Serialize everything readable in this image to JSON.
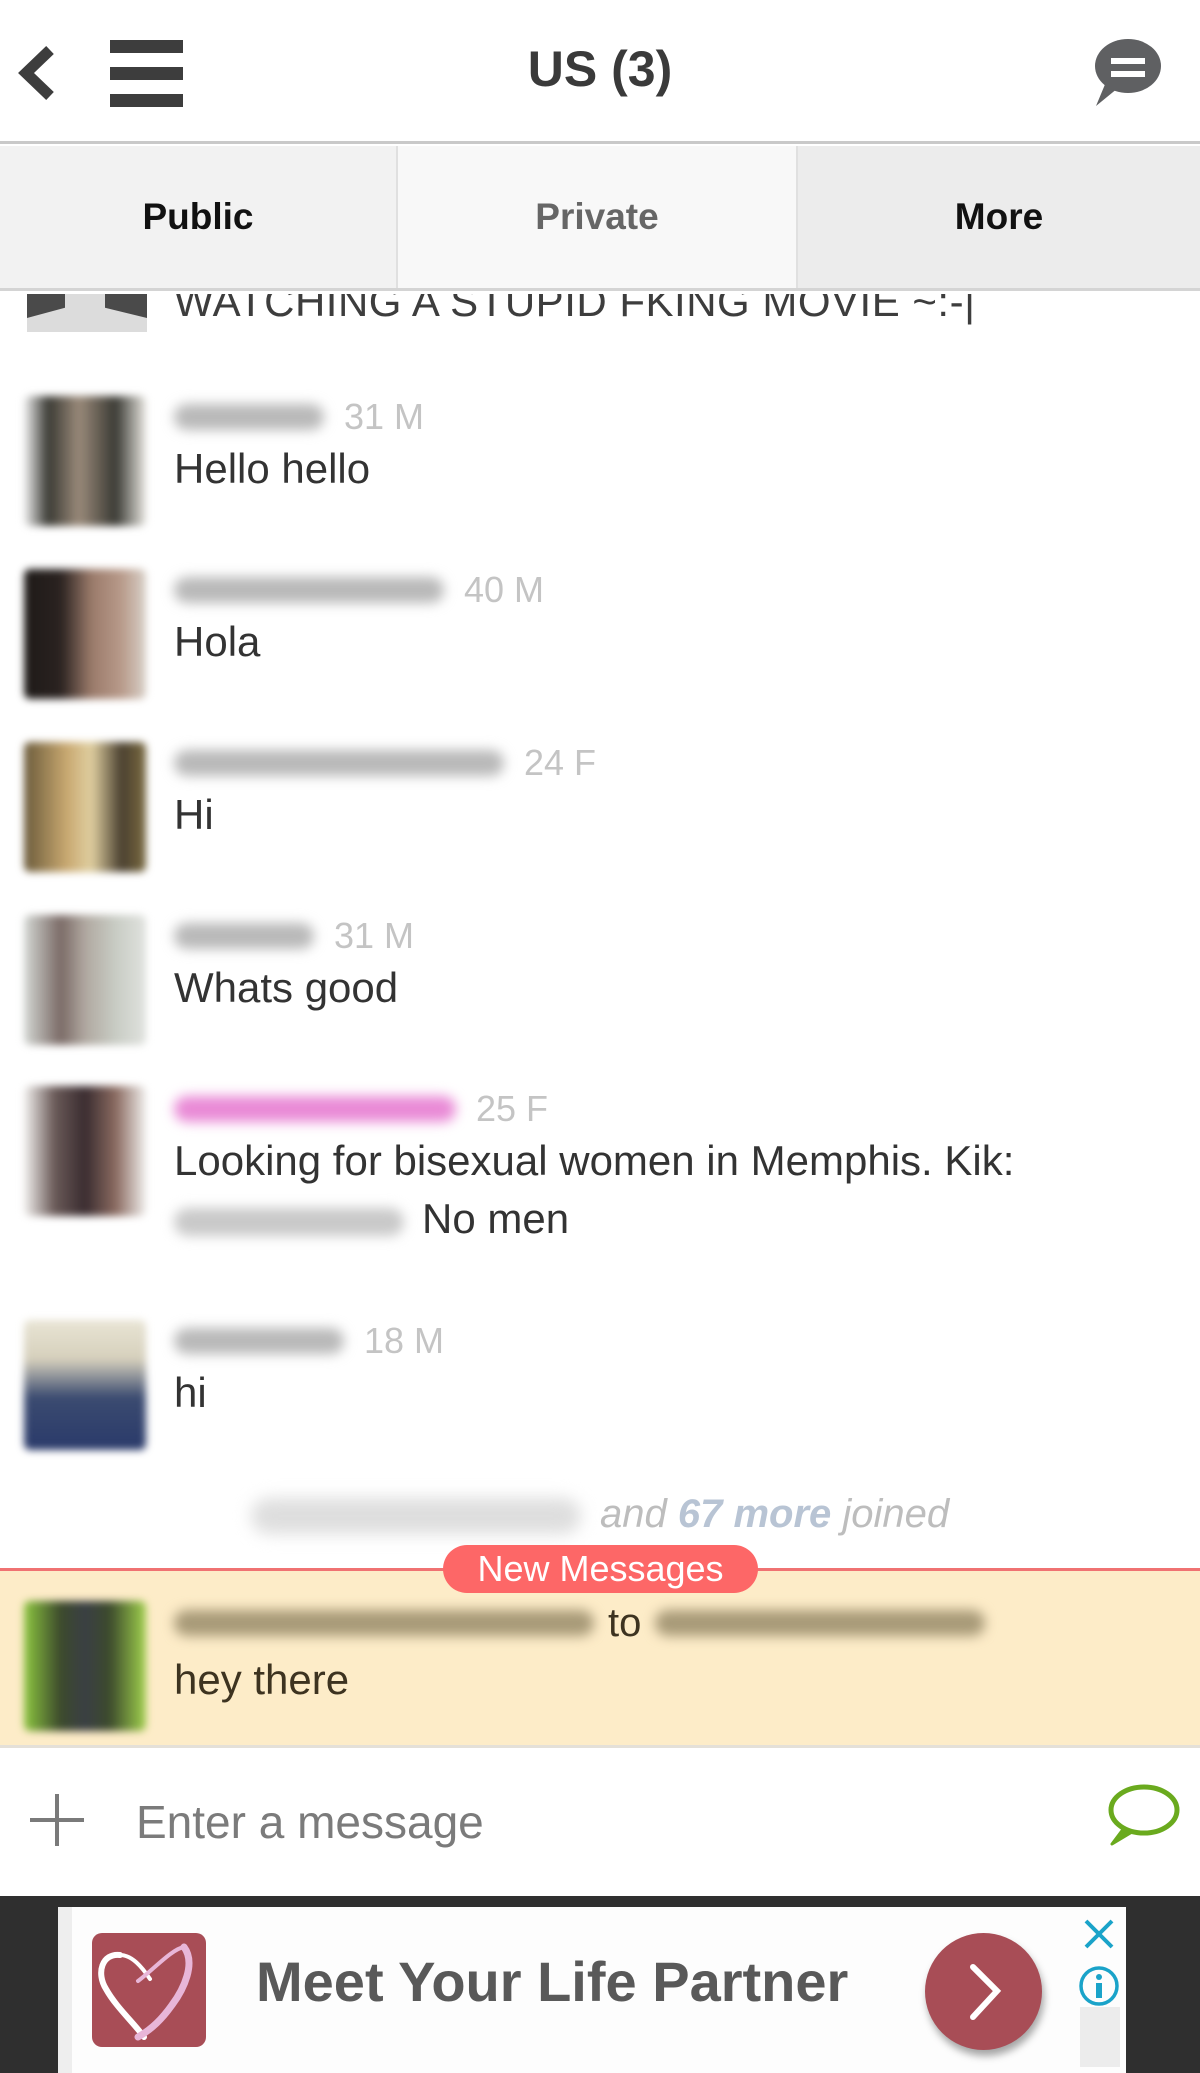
{
  "header": {
    "title": "US (3)",
    "back_icon": "chevron-left-icon",
    "menu_icon": "hamburger-menu-icon",
    "chat_icon": "chat-bubble-icon"
  },
  "tabs": [
    {
      "label": "Public",
      "active": true
    },
    {
      "label": "Private",
      "active": false
    },
    {
      "label": "More",
      "active": false
    }
  ],
  "messages": {
    "partial_top": {
      "text": "WATCHING A STUPID FKING MOVIE ~:-|"
    },
    "items": [
      {
        "username_blurred": true,
        "username_color": "#b9b9b9",
        "age_sex": "31 M",
        "text": "Hello hello"
      },
      {
        "username_blurred": true,
        "username_color": "#b9b9b9",
        "age_sex": "40 M",
        "text": "Hola"
      },
      {
        "username_blurred": true,
        "username_color": "#b9b9b9",
        "age_sex": "24 F",
        "text": "Hi"
      },
      {
        "username_blurred": true,
        "username_color": "#b9b9b9",
        "age_sex": "31 M",
        "text": "Whats good"
      },
      {
        "username_blurred": true,
        "username_color": "#e98ad6",
        "age_sex": "25 F",
        "text_line1": "Looking for bisexual women in Memphis. Kik:",
        "text_line2_suffix": "No men"
      },
      {
        "username_blurred": true,
        "username_color": "#b9b9b9",
        "age_sex": "18 M",
        "text": "hi"
      }
    ],
    "joined_notice": {
      "prefix": "and",
      "count_label": "67 more",
      "suffix": "joined"
    }
  },
  "new_messages": {
    "badge_label": "New Messages",
    "item": {
      "connector": "to",
      "text": "hey there"
    },
    "highlight_color": "#fdecc8",
    "divider_color": "#f07272"
  },
  "composer": {
    "placeholder": "Enter a message",
    "value": "",
    "attach_icon": "plus-icon",
    "send_icon": "speech-bubble-outline-icon",
    "send_color": "#6aaa1e"
  },
  "ad": {
    "headline": "Meet Your Life Partner",
    "brand_color": "#a84d56",
    "close_icon": "close-icon",
    "info_icon": "info-icon",
    "accent_color": "#1aa3c9"
  }
}
